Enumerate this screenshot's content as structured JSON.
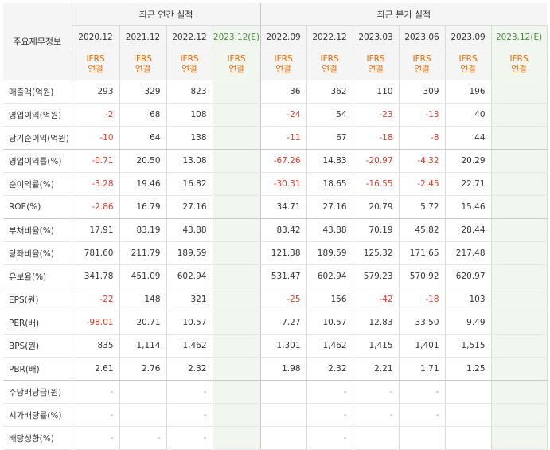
{
  "header": {
    "row_label": "주요재무정보",
    "annual_title": "최근 연간 실적",
    "quarter_title": "최근 분기 실적",
    "annual_periods": [
      "2020.12",
      "2021.12",
      "2022.12",
      "2023.12(E)"
    ],
    "quarter_periods": [
      "2022.09",
      "2022.12",
      "2023.03",
      "2023.06",
      "2023.09",
      "2023.12(E)"
    ],
    "ifrs_label": "IFRS",
    "basis_label": "연결"
  },
  "rows": [
    {
      "label": "매출액(억원)",
      "annual": [
        "293",
        "329",
        "823",
        ""
      ],
      "quarter": [
        "36",
        "362",
        "110",
        "309",
        "196",
        ""
      ]
    },
    {
      "label": "영업이익(억원)",
      "annual": [
        "-2",
        "68",
        "108",
        ""
      ],
      "quarter": [
        "-24",
        "54",
        "-23",
        "-13",
        "40",
        ""
      ]
    },
    {
      "label": "당기순이익(억원)",
      "annual": [
        "-10",
        "64",
        "138",
        ""
      ],
      "quarter": [
        "-11",
        "67",
        "-18",
        "-8",
        "44",
        ""
      ]
    },
    {
      "label": "영업이익률(%)",
      "annual": [
        "-0.71",
        "20.50",
        "13.08",
        ""
      ],
      "quarter": [
        "-67.26",
        "14.83",
        "-20.97",
        "-4.32",
        "20.29",
        ""
      ]
    },
    {
      "label": "순이익률(%)",
      "annual": [
        "-3.28",
        "19.46",
        "16.82",
        ""
      ],
      "quarter": [
        "-30.31",
        "18.65",
        "-16.55",
        "-2.45",
        "22.71",
        ""
      ]
    },
    {
      "label": "ROE(%)",
      "annual": [
        "-2.86",
        "16.79",
        "27.16",
        ""
      ],
      "quarter": [
        "34.71",
        "27.16",
        "20.79",
        "5.72",
        "15.46",
        ""
      ]
    },
    {
      "label": "부채비율(%)",
      "annual": [
        "17.91",
        "83.19",
        "43.88",
        ""
      ],
      "quarter": [
        "83.42",
        "43.88",
        "70.19",
        "45.82",
        "28.44",
        ""
      ]
    },
    {
      "label": "당좌비율(%)",
      "annual": [
        "781.60",
        "211.79",
        "189.59",
        ""
      ],
      "quarter": [
        "121.38",
        "189.59",
        "125.32",
        "171.65",
        "217.48",
        ""
      ]
    },
    {
      "label": "유보율(%)",
      "annual": [
        "341.78",
        "451.09",
        "602.94",
        ""
      ],
      "quarter": [
        "531.47",
        "602.94",
        "579.23",
        "570.92",
        "620.97",
        ""
      ]
    },
    {
      "label": "EPS(원)",
      "annual": [
        "-22",
        "148",
        "321",
        ""
      ],
      "quarter": [
        "-25",
        "156",
        "-42",
        "-18",
        "103",
        ""
      ]
    },
    {
      "label": "PER(배)",
      "annual": [
        "-98.01",
        "20.71",
        "10.57",
        ""
      ],
      "quarter": [
        "7.27",
        "10.57",
        "12.83",
        "33.50",
        "9.49",
        ""
      ]
    },
    {
      "label": "BPS(원)",
      "annual": [
        "835",
        "1,114",
        "1,462",
        ""
      ],
      "quarter": [
        "1,301",
        "1,462",
        "1,415",
        "1,401",
        "1,515",
        ""
      ]
    },
    {
      "label": "PBR(배)",
      "annual": [
        "2.61",
        "2.76",
        "2.32",
        ""
      ],
      "quarter": [
        "1.98",
        "2.32",
        "2.21",
        "1.71",
        "1.25",
        ""
      ]
    },
    {
      "label": "주당배당금(원)",
      "annual": [
        "-",
        "",
        "-",
        ""
      ],
      "quarter": [
        "",
        "-",
        "-",
        "-",
        "",
        ""
      ]
    },
    {
      "label": "시가배당률(%)",
      "annual": [
        "-",
        "",
        "-",
        ""
      ],
      "quarter": [
        "",
        "-",
        "-",
        "-",
        "",
        ""
      ]
    },
    {
      "label": "배당성향(%)",
      "annual": [
        "-",
        "-",
        "-",
        ""
      ],
      "quarter": [
        "",
        "-",
        "",
        "",
        "",
        ""
      ]
    }
  ],
  "section_ends": [
    2,
    5,
    8,
    12
  ],
  "colors": {
    "negative": "#e03a28",
    "estimate_bg": "#f1f7ef",
    "ifrs": "#f06a00"
  }
}
